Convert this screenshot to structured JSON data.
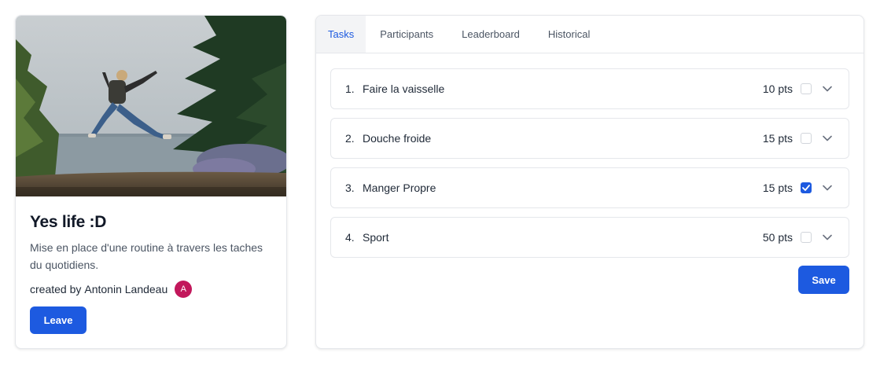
{
  "challenge": {
    "title": "Yes life :D",
    "description": "Mise en place d'une routine à travers les taches du quotidiens.",
    "creator_prefix": "created by",
    "creator_name": "Antonin Landeau",
    "avatar_initial": "A",
    "avatar_color": "#c2185b",
    "leave_label": "Leave",
    "cover_icon": "person-jumping-photo"
  },
  "tabs": [
    {
      "label": "Tasks",
      "active": true
    },
    {
      "label": "Participants",
      "active": false
    },
    {
      "label": "Leaderboard",
      "active": false
    },
    {
      "label": "Historical",
      "active": false
    }
  ],
  "tasks": [
    {
      "number": "1.",
      "name": "Faire la vaisselle",
      "points": "10 pts",
      "checked": false
    },
    {
      "number": "2.",
      "name": "Douche froide",
      "points": "15 pts",
      "checked": false
    },
    {
      "number": "3.",
      "name": "Manger Propre",
      "points": "15 pts",
      "checked": true
    },
    {
      "number": "4.",
      "name": "Sport",
      "points": "50 pts",
      "checked": false
    }
  ],
  "save_label": "Save",
  "colors": {
    "accent": "#1d5ae0",
    "border": "#e5e7eb"
  }
}
